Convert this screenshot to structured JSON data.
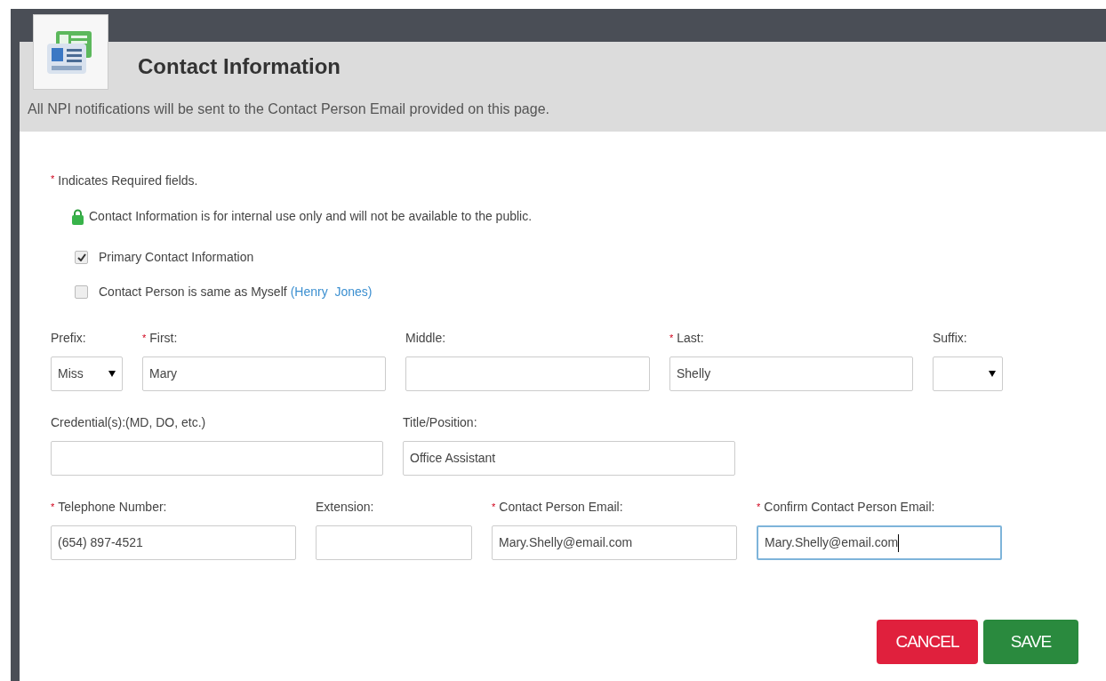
{
  "header": {
    "title": "Contact Information",
    "notice": "All NPI notifications will be sent to the Contact Person Email provided on this page."
  },
  "required_note": {
    "mark": "*",
    "text": "Indicates Required fields."
  },
  "privacy_note": "Contact Information is for internal use only and will not be available to the public.",
  "checkboxes": [
    {
      "label": "Primary Contact Information",
      "checked": true
    },
    {
      "label": "Contact Person is same as Myself",
      "checked": false,
      "link": "(Henry  Jones)"
    }
  ],
  "field_rows": [
    [
      {
        "label": "Prefix:",
        "kind": "select",
        "value": "Miss"
      },
      {
        "label": "First:",
        "required_mark": "*",
        "kind": "text",
        "value": "Mary"
      },
      {
        "label": "Middle:",
        "kind": "text"
      },
      {
        "label": "Last:",
        "required_mark": "*",
        "kind": "text",
        "value": "Shelly"
      },
      {
        "label": "Suffix:",
        "kind": "select"
      }
    ],
    [
      {
        "label": "Credential(s):(MD, DO, etc.)",
        "kind": "text"
      },
      {
        "label": "Title/Position:",
        "kind": "text",
        "value": "Office Assistant"
      }
    ],
    [
      {
        "label": "Telephone Number:",
        "required_mark": "*",
        "kind": "text",
        "value": "(654) 897-4521"
      },
      {
        "label": "Extension:",
        "kind": "text"
      },
      {
        "label": "Contact Person Email:",
        "required_mark": "*",
        "kind": "text",
        "value": "Mary.Shelly@email.com"
      },
      {
        "label": "Confirm Contact Person Email:",
        "required_mark": "*",
        "kind": "text",
        "value": "Mary.Shelly@email.com",
        "focused": true
      }
    ]
  ],
  "buttons": [
    {
      "label": "CANCEL",
      "kind": "cancel"
    },
    {
      "label": "SAVE",
      "kind": "save"
    }
  ]
}
